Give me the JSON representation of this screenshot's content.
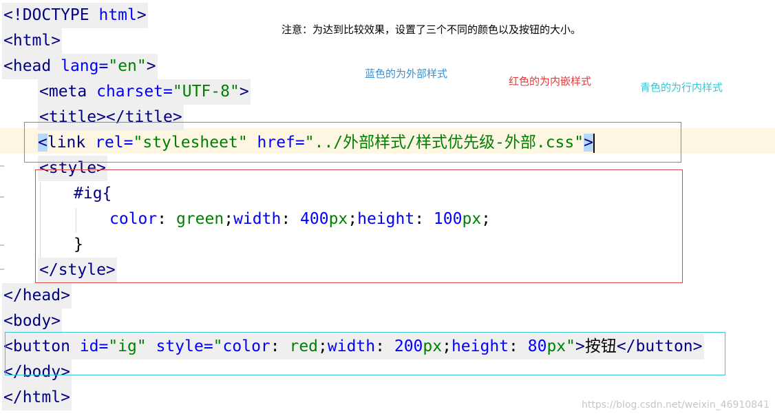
{
  "colors": {
    "external_box": "#4d95d3",
    "embedded_box": "#e04545",
    "inline_box": "#35c7d6",
    "tag": "#000080",
    "attribute": "#0000ff",
    "string": "#008000",
    "current_line": "#fdf6e3"
  },
  "annotations": {
    "note": "注意：为达到比较效果，设置了三个不同的颜色以及按钮的大小。",
    "blue_label": "蓝色的为外部样式",
    "red_label": "红色的为内嵌样式",
    "cyan_label": "青色的为行内样式"
  },
  "code": {
    "l1_open": "<!DOCTYPE ",
    "l1_kw": "html",
    "l1_close": ">",
    "l2": "<html>",
    "l3_open": "<head ",
    "l3_attr": "lang=",
    "l3_val": "\"en\"",
    "l3_close": ">",
    "l4_open": "<meta ",
    "l4_attr": "charset=",
    "l4_val": "\"UTF-8\"",
    "l4_close": ">",
    "l5": "<title></title>",
    "l6_lt": "<",
    "l6_tag": "link ",
    "l6_attr1": "rel=",
    "l6_val1": "\"stylesheet\" ",
    "l6_attr2": "href=",
    "l6_val2": "\"../外部样式/样式优先级-外部.css\"",
    "l6_gt": ">",
    "l7": "<style>",
    "l8": "#ig{",
    "l9_p1": "color",
    "l9_c1": ": ",
    "l9_v1": "green",
    "l9_s1": ";",
    "l9_p2": "width",
    "l9_c2": ": ",
    "l9_n2": "400",
    "l9_u2": "px",
    "l9_s2": ";",
    "l9_p3": "height",
    "l9_c3": ": ",
    "l9_n3": "100",
    "l9_u3": "px",
    "l9_s3": ";",
    "l10": "}",
    "l11": "</style>",
    "l12": "</head>",
    "l13": "<body>",
    "l14_open": "<button ",
    "l14_a1": "id=",
    "l14_v1": "\"ig\" ",
    "l14_a2": "style=",
    "l14_q1": "\"",
    "l14_p1": "color",
    "l14_c1": ": ",
    "l14_v2": "red",
    "l14_s1": ";",
    "l14_p2": "width",
    "l14_c2": ": ",
    "l14_n2": "200",
    "l14_u2": "px",
    "l14_s2": ";",
    "l14_p3": "height",
    "l14_c3": ": ",
    "l14_n3": "80",
    "l14_u3": "px",
    "l14_q2": "\"",
    "l14_gt": ">",
    "l14_text": "按钮",
    "l14_close": "</button>",
    "l15": "</body>",
    "l16": "</html>"
  },
  "watermark": "https://blog.csdn.net/weixin_46910841"
}
